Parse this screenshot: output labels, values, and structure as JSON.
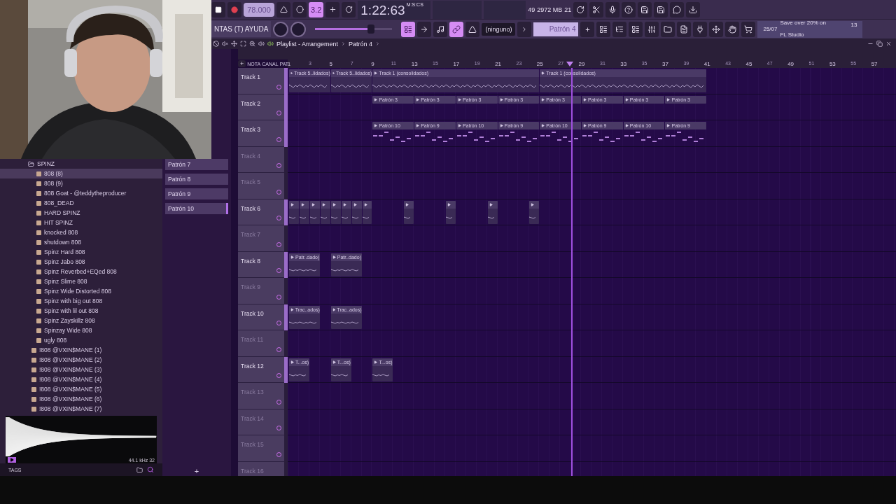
{
  "toolbar": {
    "tempo": "78.000",
    "snap_toggle": {
      "label": "3.2",
      "on": true
    },
    "time": "1:22:63",
    "time_format": "M:S:CS",
    "cpu": "49",
    "ram": "2972 MB",
    "polyphony": "21",
    "menu": "NTAS (T) AYUDA",
    "master_slider": {
      "level": 0.72
    },
    "tool_buttons": [
      {
        "on": true
      },
      {
        "on": false
      },
      {
        "on": false
      },
      {
        "on": true
      },
      {
        "on": false
      }
    ],
    "snap": "(ninguno)",
    "pattern": "Patrón 4",
    "pattern_add": "+",
    "news": {
      "date": "25/07",
      "headline": "Save over 20% on",
      "subline": "FL Studio",
      "count": "13"
    }
  },
  "browser": {
    "tree": [
      {
        "label": "SPINZ",
        "kind": "folder",
        "expanded": true,
        "children": [
          {
            "label": "808 (8)",
            "kind": "pack",
            "selected": true
          },
          {
            "label": "808 (9)",
            "kind": "pack",
            "selected": false
          },
          {
            "label": "808 Goat - @teddytheproducer",
            "kind": "pack",
            "selected": false
          },
          {
            "label": "808_DEAD",
            "kind": "pack",
            "selected": false
          },
          {
            "label": "HARD SPINZ",
            "kind": "pack",
            "selected": false
          },
          {
            "label": "HIT SPINZ",
            "kind": "pack",
            "selected": false
          },
          {
            "label": "knocked 808",
            "kind": "pack",
            "selected": false
          },
          {
            "label": "shutdown 808",
            "kind": "pack",
            "selected": false
          },
          {
            "label": "Spinz Hard 808",
            "kind": "pack",
            "selected": false
          },
          {
            "label": "Spinz Jabo 808",
            "kind": "pack",
            "selected": false
          },
          {
            "label": "Spinz Reverbed+EQed 808",
            "kind": "pack",
            "selected": false
          },
          {
            "label": "Spinz Slime 808",
            "kind": "pack",
            "selected": false
          },
          {
            "label": "Spinz Wide Distorted 808",
            "kind": "pack",
            "selected": false
          },
          {
            "label": "Spinz with big out 808",
            "kind": "pack",
            "selected": false
          },
          {
            "label": "Spinz with lil out 808",
            "kind": "pack",
            "selected": false
          },
          {
            "label": "Spinz Zayskillz 808",
            "kind": "pack",
            "selected": false
          },
          {
            "label": "Spinzay Wide 808",
            "kind": "pack",
            "selected": false
          },
          {
            "label": "ugly 808",
            "kind": "pack",
            "selected": false
          }
        ]
      },
      {
        "label": "!808 @VXIN$MANE (1)",
        "kind": "pack",
        "selected": false
      },
      {
        "label": "!808 @VXIN$MANE (2)",
        "kind": "pack",
        "selected": false
      },
      {
        "label": "!808 @VXIN$MANE (3)",
        "kind": "pack",
        "selected": false
      },
      {
        "label": "!808 @VXIN$MANE (4)",
        "kind": "pack",
        "selected": false
      },
      {
        "label": "!808 @VXIN$MANE (5)",
        "kind": "pack",
        "selected": false
      },
      {
        "label": "!808 @VXIN$MANE (6)",
        "kind": "pack",
        "selected": false
      },
      {
        "label": "!808 @VXIN$MANE (7)",
        "kind": "pack",
        "selected": false
      }
    ],
    "preview_info": "44.1 kHz 32",
    "tags": "TAGS"
  },
  "patterns": {
    "items": [
      {
        "label": "Patrón 7",
        "selected": false
      },
      {
        "label": "Patrón 8",
        "selected": false
      },
      {
        "label": "Patrón 9",
        "selected": false
      },
      {
        "label": "Patrón 10",
        "selected": true
      }
    ],
    "add": "+"
  },
  "playlist": {
    "title": "Playlist - Arrangement",
    "pattern": "Patrón 4",
    "header_modes": [
      "NOTA",
      "CANAL",
      "PAT"
    ],
    "add": "+",
    "ruler": [
      "1",
      "3",
      "5",
      "7",
      "9",
      "11",
      "13",
      "15",
      "17",
      "19",
      "21",
      "23",
      "25",
      "27",
      "29",
      "31",
      "33",
      "35",
      "37",
      "39",
      "41",
      "43",
      "45",
      "47",
      "49",
      "51",
      "53",
      "55",
      "57"
    ],
    "tracks": [
      {
        "name": "Track 1",
        "dimmed": false,
        "clips": [
          {
            "kind": "audio",
            "label": "Track 5..lidados)"
          },
          {
            "kind": "audio",
            "label": "Track 5..lidados)"
          },
          {
            "kind": "audio",
            "label": "Track 1 (consolidados)"
          },
          {
            "kind": "audio",
            "label": "Track 1 (consolidados)"
          }
        ]
      },
      {
        "name": "Track 2",
        "dimmed": false,
        "clips": [
          {
            "kind": "pattern",
            "label": "Patrón 3"
          },
          {
            "kind": "pattern",
            "label": "Patrón 3"
          },
          {
            "kind": "pattern",
            "label": "Patrón 3"
          },
          {
            "kind": "pattern",
            "label": "Patrón 3"
          },
          {
            "kind": "pattern",
            "label": "Patrón 3"
          },
          {
            "kind": "pattern",
            "label": "Patrón 3"
          },
          {
            "kind": "pattern",
            "label": "Patrón 3"
          },
          {
            "kind": "pattern",
            "label": "Patrón 3"
          }
        ]
      },
      {
        "name": "Track 3",
        "dimmed": false,
        "clips": [
          {
            "kind": "notes",
            "label": "Patrón 10"
          },
          {
            "kind": "notes",
            "label": "Patrón 9"
          },
          {
            "kind": "notes",
            "label": "Patrón 10"
          },
          {
            "kind": "notes",
            "label": "Patrón 9"
          },
          {
            "kind": "notes",
            "label": "Patrón 10"
          },
          {
            "kind": "notes",
            "label": "Patrón 9"
          },
          {
            "kind": "notes",
            "label": "Patrón 10"
          },
          {
            "kind": "notes",
            "label": "Patrón 9"
          }
        ]
      },
      {
        "name": "Track 4",
        "dimmed": true
      },
      {
        "name": "Track 5",
        "dimmed": true
      },
      {
        "name": "Track 6",
        "dimmed": false,
        "clips": [
          {
            "kind": "audio"
          },
          {
            "kind": "audio"
          },
          {
            "kind": "audio"
          },
          {
            "kind": "audio"
          },
          {
            "kind": "audio"
          },
          {
            "kind": "audio"
          },
          {
            "kind": "audio"
          },
          {
            "kind": "audio"
          },
          {
            "kind": "audio"
          },
          {
            "kind": "audio"
          },
          {
            "kind": "audio"
          },
          {
            "kind": "audio"
          }
        ]
      },
      {
        "name": "Track 7",
        "dimmed": true
      },
      {
        "name": "Track 8",
        "dimmed": false,
        "clips": [
          {
            "kind": "audio",
            "label": "Patr..dado)"
          },
          {
            "kind": "audio",
            "label": "Patr..dado)"
          }
        ]
      },
      {
        "name": "Track 9",
        "dimmed": true
      },
      {
        "name": "Track 10",
        "dimmed": false,
        "clips": [
          {
            "kind": "audio",
            "label": "Trac..ados)"
          },
          {
            "kind": "audio",
            "label": "Trac..ados)"
          }
        ]
      },
      {
        "name": "Track 11",
        "dimmed": true
      },
      {
        "name": "Track 12",
        "dimmed": false,
        "clips": [
          {
            "kind": "audio",
            "label": "T...os)"
          },
          {
            "kind": "audio",
            "label": "T...os)"
          },
          {
            "kind": "audio",
            "label": "T...os)"
          }
        ]
      },
      {
        "name": "Track 13",
        "dimmed": true
      },
      {
        "name": "Track 14",
        "dimmed": true
      },
      {
        "name": "Track 15",
        "dimmed": true
      },
      {
        "name": "Track 16",
        "dimmed": true
      }
    ]
  }
}
